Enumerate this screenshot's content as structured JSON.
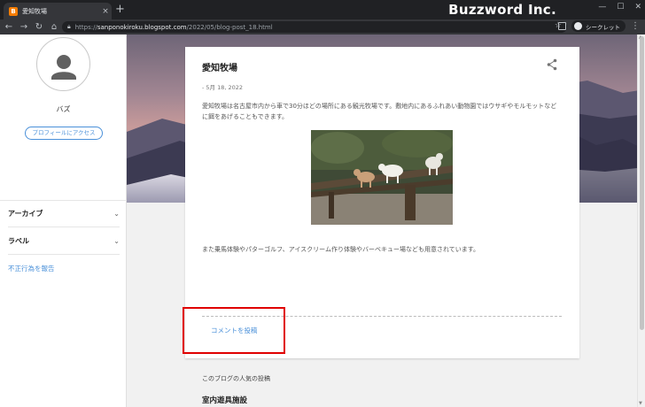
{
  "browser": {
    "tab_title": "愛知牧場",
    "tab_close": "×",
    "new_tab": "+",
    "brand_overlay": "Buzzword Inc.",
    "window_controls": [
      "—",
      "☐",
      "✕"
    ],
    "url_scheme": "https://",
    "url_host": "sanponokiroku.blogspot.com",
    "url_path": "/2022/05/blog-post_18.html",
    "incognito_label": "シークレット",
    "icons": [
      "back-icon",
      "forward-icon",
      "reload-icon",
      "home-icon",
      "lock-icon",
      "star-icon",
      "side-panel-icon",
      "incognito-icon",
      "menu-icon"
    ]
  },
  "sidebar": {
    "profile_name": "バズ",
    "profile_button": "プロフィールにアクセス",
    "items": [
      {
        "label": "アーカイブ"
      },
      {
        "label": "ラベル"
      }
    ],
    "report_link": "不正行為を報告"
  },
  "post": {
    "title": "愛知牧場",
    "date": "- 5月 18, 2022",
    "body": "愛知牧場は名古屋市内から車で30分ほどの場所にある観光牧場です。敷地内にあるふれあい動物園ではウサギやモルモットなどに餌をあげることもできます。",
    "body2": "また乗馬体験やパターゴルフ、アイスクリーム作り体験やバーベキュー場なども用意されています。",
    "comment_link": "コメントを投稿"
  },
  "popular": {
    "heading": "このブログの人気の投稿",
    "first_title": "室内遊具施設"
  },
  "colors": {
    "link": "#4a90d9",
    "highlight_box": "#e00000",
    "chrome_dark": "#202124",
    "chrome_toolbar": "#35363a"
  }
}
